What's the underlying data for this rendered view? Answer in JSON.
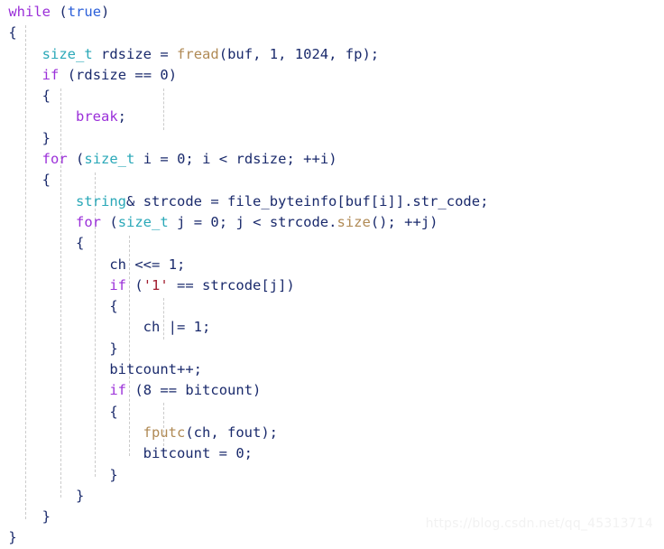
{
  "editor": {
    "language": "cpp",
    "background": "#ffffff",
    "font_size_px": 15.5,
    "line_height_px": 23.3,
    "indent_guide_color": "#cbcbcb",
    "colors": {
      "keyword": "#9b30d9",
      "type": "#2aa8b8",
      "function": "#b08a55",
      "literal_bool": "#2b5fd9",
      "string": "#a01c2e",
      "identifier": "#1a2a6c",
      "punctuation": "#1a2a6c"
    }
  },
  "code": {
    "lines": [
      "while (true)",
      "{",
      "    size_t rdsize = fread(buf, 1, 1024, fp);",
      "    if (rdsize == 0)",
      "    {",
      "        break;",
      "    }",
      "    for (size_t i = 0; i < rdsize; ++i)",
      "    {",
      "        string& strcode = file_byteinfo[buf[i]].str_code;",
      "        for (size_t j = 0; j < strcode.size(); ++j)",
      "        {",
      "            ch <<= 1;",
      "            if ('1' == strcode[j])",
      "            {",
      "                ch |= 1;",
      "            }",
      "            bitcount++;",
      "            if (8 == bitcount)",
      "            {",
      "                fputc(ch, fout);",
      "                bitcount = 0;",
      "            }",
      "        }",
      "    }",
      "}"
    ],
    "line_count": 25
  },
  "watermark": {
    "text": "https://blog.csdn.net/qq_45313714",
    "color": "#f2f2f2"
  },
  "indent_guides": {
    "x_positions": [
      28,
      67,
      105,
      143,
      181
    ]
  }
}
